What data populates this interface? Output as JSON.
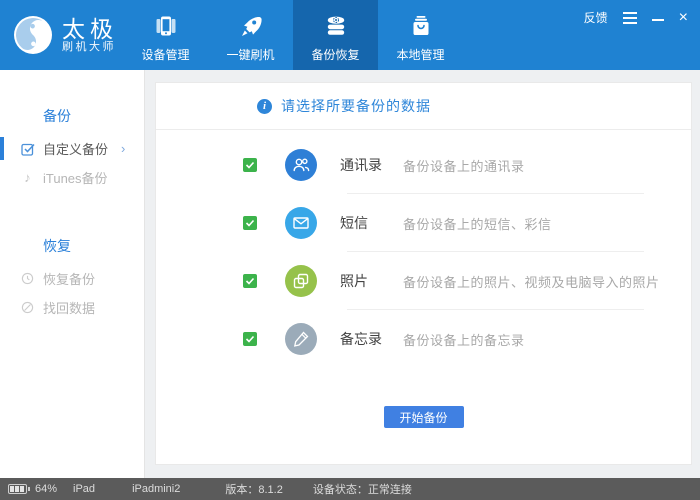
{
  "brand": {
    "title": "太极",
    "subtitle": "刷机大师",
    "logo_icon": "taiji-logo"
  },
  "window_controls": {
    "feedback_label": "反馈",
    "icons": [
      "menu-icon",
      "minimize-icon",
      "close-icon"
    ]
  },
  "nav": {
    "items": [
      {
        "label": "设备管理",
        "icon": "device-manage-icon",
        "active": false
      },
      {
        "label": "一键刷机",
        "icon": "rocket-icon",
        "active": false
      },
      {
        "label": "备份恢复",
        "icon": "database-icon",
        "active": true
      },
      {
        "label": "本地管理",
        "icon": "bag-icon",
        "active": false
      }
    ]
  },
  "sidebar": {
    "sections": [
      {
        "title": "备份",
        "items": [
          {
            "label": "自定义备份",
            "icon": "custom-backup-icon",
            "selected": true,
            "chevron": "›"
          },
          {
            "label": "iTunes备份",
            "icon": "music-note-icon",
            "selected": false
          }
        ]
      },
      {
        "title": "恢复",
        "items": [
          {
            "label": "恢复备份",
            "icon": "restore-backup-icon",
            "selected": false
          },
          {
            "label": "找回数据",
            "icon": "recover-data-icon",
            "selected": false
          }
        ]
      }
    ]
  },
  "main": {
    "banner_text": "请选择所要备份的数据",
    "items": [
      {
        "title": "通讯录",
        "desc": "备份设备上的通讯录",
        "checked": true,
        "icon": "contacts-icon",
        "color": "#2e7fd6"
      },
      {
        "title": "短信",
        "desc": "备份设备上的短信、彩信",
        "checked": true,
        "icon": "sms-icon",
        "color": "#38a7e8"
      },
      {
        "title": "照片",
        "desc": "备份设备上的照片、视频及电脑导入的照片",
        "checked": true,
        "icon": "photos-icon",
        "color": "#96c24b"
      },
      {
        "title": "备忘录",
        "desc": "备份设备上的备忘录",
        "checked": true,
        "icon": "notes-icon",
        "color": "#9babb9"
      }
    ],
    "start_button_label": "开始备份"
  },
  "statusbar": {
    "battery_percent": "64%",
    "device_type": "iPad",
    "device_name": "iPadmini2",
    "version_label": "版本：8.1.2",
    "status_label": "设备状态：正常连接"
  },
  "colors": {
    "header": "#1f82d2",
    "header_active_tab": "#1566ad",
    "accent_blue": "#2e86d9",
    "checkbox_green": "#3cb34b",
    "button_blue": "#4080e2",
    "statusbar_gray": "#5b5b5b"
  }
}
